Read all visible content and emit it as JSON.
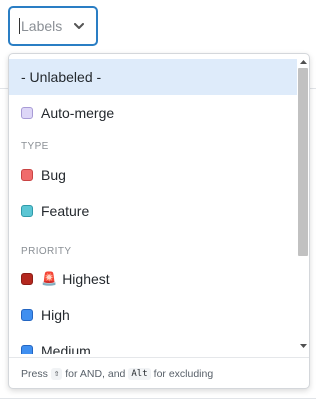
{
  "labels_select": {
    "placeholder": "Labels",
    "accent": "#2a7ec4"
  },
  "dropdown": {
    "options": [
      {
        "label": "- Unlabeled -",
        "highlighted": true
      },
      {
        "label": "Auto-merge",
        "color": "#ddd6f7",
        "border": "#a89bd6"
      },
      {
        "label": "Bug",
        "color": "#f06b6b",
        "border": "#c94444"
      },
      {
        "label": "Feature",
        "color": "#5bc6d4",
        "border": "#2f9aa9"
      },
      {
        "label": "Highest",
        "emoji": "🚨",
        "color": "#b4281f",
        "border": "#8c1d16"
      },
      {
        "label": "High",
        "color": "#3f8ff0",
        "border": "#2466c2"
      },
      {
        "label": "Medium",
        "color": "#3f8ff0",
        "border": "#2466c2"
      }
    ],
    "groups": {
      "type": "TYPE",
      "priority": "PRIORITY"
    },
    "footer": {
      "press": "Press",
      "shift_key": "⇧",
      "and_text": "for AND, and",
      "alt_key": "Alt",
      "excluding_text": "for excluding"
    }
  },
  "icons": {
    "chevron": "chevron-down-icon",
    "scroll_up": "scroll-up-arrow-icon",
    "scroll_down": "scroll-down-arrow-icon"
  }
}
